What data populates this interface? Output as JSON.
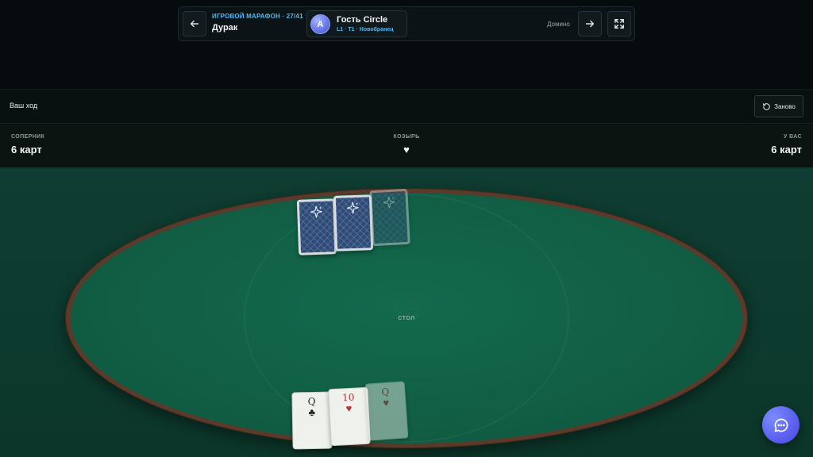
{
  "header": {
    "marathon_label": "ИГРОВОЙ МАРАФОН · 27/41",
    "game_name": "Дурак",
    "player": {
      "avatar_letter": "A",
      "name": "Гость Circle",
      "subtitle": "L1 · T1 · Новобранец"
    },
    "next_game_label": "Домино",
    "icons": {
      "back": "arrow-left-icon",
      "forward": "arrow-right-icon",
      "fullscreen": "fullscreen-icon"
    }
  },
  "status": {
    "turn_text": "Ваш ход",
    "restart_label": "Заново"
  },
  "info": {
    "opponent_label": "СОПЕРНИК",
    "opponent_cards": "6 карт",
    "trump_label": "КОЗЫРЬ",
    "trump_suit": "♥",
    "you_label": "У ВАС",
    "you_cards": "6 карт"
  },
  "table": {
    "label": "СТОЛ",
    "opponent_card_backs": 3,
    "player_cards": [
      {
        "rank": "Q",
        "suit": "♣",
        "color": "black"
      },
      {
        "rank": "10",
        "suit": "♥",
        "color": "red"
      },
      {
        "rank": "Q",
        "suit": "♥",
        "color": "red"
      }
    ]
  },
  "colors": {
    "accent": "#4fb7ee",
    "felt": "#115f45",
    "rim": "#5a3a2a",
    "chat": "#5b5ff0"
  }
}
